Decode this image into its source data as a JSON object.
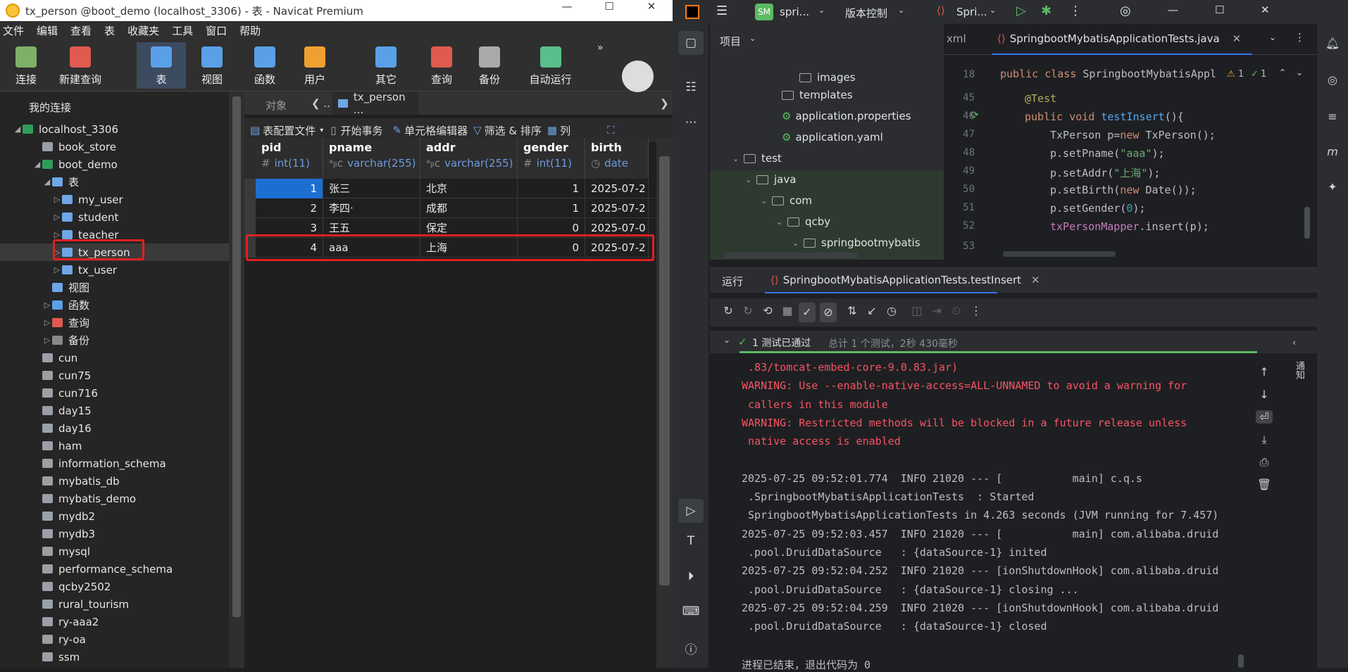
{
  "navicat": {
    "title": "tx_person @boot_demo (localhost_3306) - 表 - Navicat Premium",
    "menu": [
      "文件",
      "编辑",
      "查看",
      "表",
      "收藏夹",
      "工具",
      "窗口",
      "帮助"
    ],
    "toolbar": [
      {
        "label": "连接",
        "icon": "connect-icon",
        "color": "#7fb069"
      },
      {
        "label": "新建查询",
        "icon": "new-query-icon",
        "color": "#e05a4f"
      },
      {
        "label": "表",
        "icon": "table-icon",
        "color": "#5aa0e6"
      },
      {
        "label": "视图",
        "icon": "view-icon",
        "color": "#5aa0e6"
      },
      {
        "label": "函数",
        "icon": "function-icon",
        "color": "#5aa0e6"
      },
      {
        "label": "用户",
        "icon": "user-icon",
        "color": "#f0a030"
      },
      {
        "label": "其它",
        "icon": "tools-icon",
        "color": "#5aa0e6"
      },
      {
        "label": "查询",
        "icon": "query-icon",
        "color": "#e05a4f"
      },
      {
        "label": "备份",
        "icon": "backup-icon",
        "color": "#aaaaaa"
      },
      {
        "label": "自动运行",
        "icon": "robot-icon",
        "color": "#5abf8a"
      }
    ],
    "tree": {
      "root": "我的连接",
      "connection": "localhost_3306",
      "databases_top": [
        "book_store",
        "boot_demo"
      ],
      "table_group": "表",
      "tables": [
        "my_user",
        "student",
        "teacher",
        "tx_person",
        "tx_user"
      ],
      "view_group": "视图",
      "function_group": "函数",
      "query_group": "查询",
      "backup_group": "备份",
      "databases_rest": [
        "cun",
        "cun75",
        "cun716",
        "day15",
        "day16",
        "ham",
        "information_schema",
        "mybatis_db",
        "mybatis_demo",
        "mydb2",
        "mydb3",
        "mysql",
        "performance_schema",
        "qcby2502",
        "rural_tourism",
        "ry-aaa2",
        "ry-oa",
        "ssm"
      ]
    },
    "tabs": {
      "objects": "对象",
      "current": "tx_person ..."
    },
    "subtool": [
      "表配置文件",
      "开始事务",
      "单元格编辑器",
      "筛选 & 排序",
      "列"
    ],
    "columns": [
      {
        "name": "pid",
        "type": "int(11)"
      },
      {
        "name": "pname",
        "type": "varchar(255)"
      },
      {
        "name": "addr",
        "type": "varchar(255)"
      },
      {
        "name": "gender",
        "type": "int(11)"
      },
      {
        "name": "birth",
        "type": "date"
      }
    ],
    "rows": [
      [
        "1",
        "张三",
        "北京",
        "1",
        "2025-07-2"
      ],
      [
        "2",
        "李四·",
        "成都",
        "1",
        "2025-07-2"
      ],
      [
        "3",
        "王五",
        "保定",
        "0",
        "2025-07-0"
      ],
      [
        "4",
        "aaa",
        "上海",
        "0",
        "2025-07-2"
      ]
    ]
  },
  "ide": {
    "project_badge": "SM",
    "project_name": "spri...",
    "vcs": "版本控制",
    "run_config": "Spri...",
    "panel_title": "项目",
    "tree": [
      "images",
      "templates",
      "application.properties",
      "application.yaml",
      "test",
      "java",
      "com",
      "qcby",
      "springbootmybatis"
    ],
    "tab_left": "xml",
    "tab_file": "SpringbootMybatisApplicationTests.java",
    "warn_count": "1",
    "ok_count": "1",
    "lines": [
      "18",
      "45",
      "46",
      "47",
      "48",
      "49",
      "50",
      "51",
      "52",
      "53"
    ],
    "code": {
      "l18a": "public class ",
      "l18b": "SpringbootMybatisAppl",
      "l45": "@Test",
      "l46a": "public void ",
      "l46b": "testInsert",
      "l46c": "(){",
      "l47": "TxPerson p=",
      "l47k": "new",
      "l47b": " TxPerson();",
      "l48a": "p.setPname(",
      "l48s": "\"aaa\"",
      "l48b": ");",
      "l49a": "p.setAddr(",
      "l49s": "\"上海\"",
      "l49b": ");",
      "l50a": "p.setBirth(",
      "l50k": "new",
      "l50b": " Date());",
      "l51a": "p.setGender(",
      "l51n": "0",
      "l51b": ");",
      "l52a": "txPersonMapper",
      "l52b": ".insert(p);"
    },
    "run_tab": "运行",
    "run_name": "SpringbootMybatisApplicationTests.testInsert",
    "test_status": "1 测试已通过",
    "test_summary": "总计 1 个测试，2秒 430毫秒",
    "console": [
      {
        "t": " .83/tomcat-embed-core-9.0.83.jar)",
        "c": "warn"
      },
      {
        "t": "WARNING: Use --enable-native-access=ALL-UNNAMED to avoid a warning for",
        "c": "warn"
      },
      {
        "t": " callers in this module",
        "c": "warn"
      },
      {
        "t": "WARNING: Restricted methods will be blocked in a future release unless",
        "c": "warn"
      },
      {
        "t": " native access is enabled",
        "c": "warn"
      },
      {
        "t": "",
        "c": ""
      },
      {
        "t": "2025-07-25 09:52:01.774  INFO 21020 --- [           main] c.q.s",
        "c": ""
      },
      {
        "t": " .SpringbootMybatisApplicationTests  : Started",
        "c": ""
      },
      {
        "t": " SpringbootMybatisApplicationTests in 4.263 seconds (JVM running for 7.457)",
        "c": ""
      },
      {
        "t": "2025-07-25 09:52:03.457  INFO 21020 --- [           main] com.alibaba.druid",
        "c": ""
      },
      {
        "t": " .pool.DruidDataSource   : {dataSource-1} inited",
        "c": ""
      },
      {
        "t": "2025-07-25 09:52:04.252  INFO 21020 --- [ionShutdownHook] com.alibaba.druid",
        "c": ""
      },
      {
        "t": " .pool.DruidDataSource   : {dataSource-1} closing ...",
        "c": ""
      },
      {
        "t": "2025-07-25 09:52:04.259  INFO 21020 --- [ionShutdownHook] com.alibaba.druid",
        "c": ""
      },
      {
        "t": " .pool.DruidDataSource   : {dataSource-1} closed",
        "c": ""
      },
      {
        "t": "",
        "c": ""
      },
      {
        "t": "进程已结束，退出代码为 0",
        "c": ""
      }
    ],
    "right_label": "通知"
  }
}
